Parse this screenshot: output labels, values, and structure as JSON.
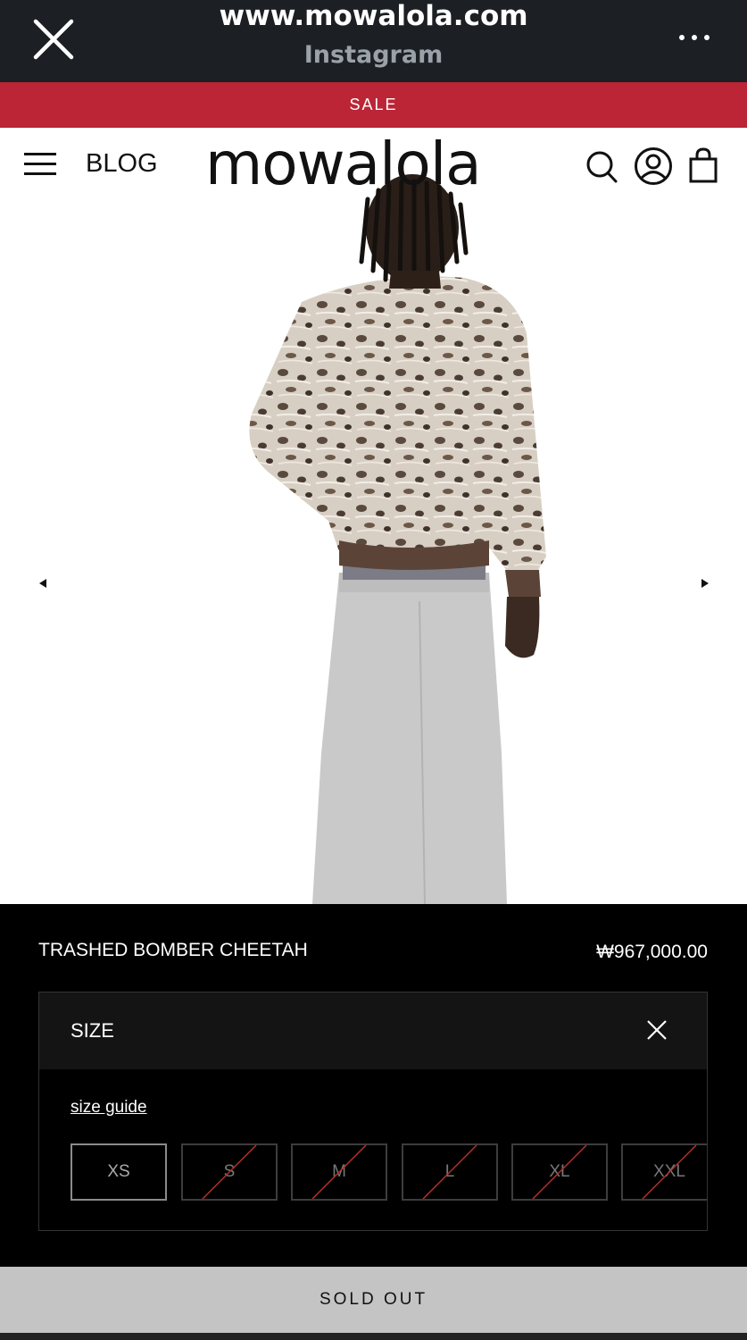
{
  "browser": {
    "url": "www.mowalola.com",
    "subtitle": "Instagram"
  },
  "banner": {
    "text": "SALE"
  },
  "header": {
    "blog_label": "BLOG",
    "logo_text": "mowalola"
  },
  "product": {
    "name": "TRASHED BOMBER CHEETAH",
    "price": "₩967,000.00"
  },
  "size_panel": {
    "label": "SIZE",
    "guide_link": "size guide",
    "options": [
      "XS",
      "S",
      "M",
      "L",
      "XL",
      "XXL"
    ]
  },
  "cta": {
    "label": "SOLD OUT"
  },
  "colors": {
    "browser_bar": "#1c1f23",
    "sale_banner": "#bb2536",
    "strike": "#b3322c",
    "sold_out_button": "#c4c4c4"
  }
}
